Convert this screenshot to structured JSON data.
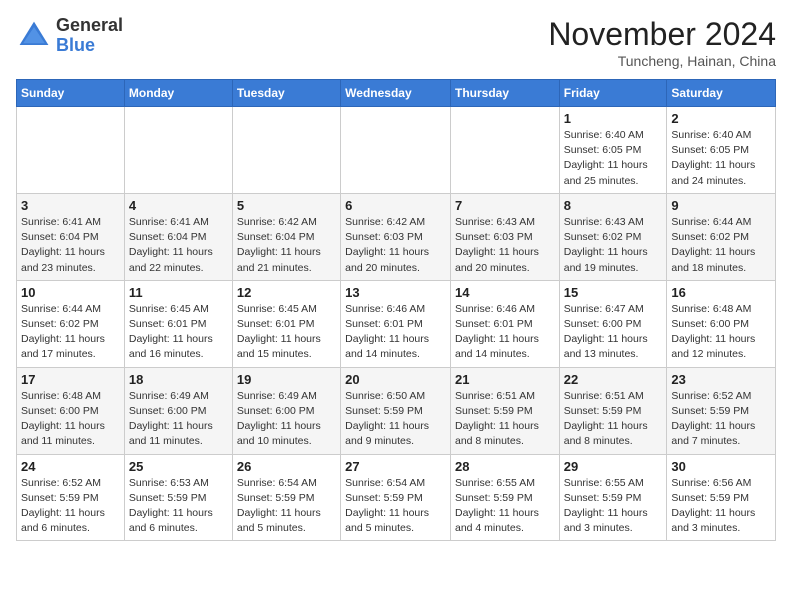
{
  "logo": {
    "general": "General",
    "blue": "Blue"
  },
  "header": {
    "month": "November 2024",
    "location": "Tuncheng, Hainan, China"
  },
  "weekdays": [
    "Sunday",
    "Monday",
    "Tuesday",
    "Wednesday",
    "Thursday",
    "Friday",
    "Saturday"
  ],
  "weeks": [
    [
      {
        "day": "",
        "info": ""
      },
      {
        "day": "",
        "info": ""
      },
      {
        "day": "",
        "info": ""
      },
      {
        "day": "",
        "info": ""
      },
      {
        "day": "",
        "info": ""
      },
      {
        "day": "1",
        "info": "Sunrise: 6:40 AM\nSunset: 6:05 PM\nDaylight: 11 hours and 25 minutes."
      },
      {
        "day": "2",
        "info": "Sunrise: 6:40 AM\nSunset: 6:05 PM\nDaylight: 11 hours and 24 minutes."
      }
    ],
    [
      {
        "day": "3",
        "info": "Sunrise: 6:41 AM\nSunset: 6:04 PM\nDaylight: 11 hours and 23 minutes."
      },
      {
        "day": "4",
        "info": "Sunrise: 6:41 AM\nSunset: 6:04 PM\nDaylight: 11 hours and 22 minutes."
      },
      {
        "day": "5",
        "info": "Sunrise: 6:42 AM\nSunset: 6:04 PM\nDaylight: 11 hours and 21 minutes."
      },
      {
        "day": "6",
        "info": "Sunrise: 6:42 AM\nSunset: 6:03 PM\nDaylight: 11 hours and 20 minutes."
      },
      {
        "day": "7",
        "info": "Sunrise: 6:43 AM\nSunset: 6:03 PM\nDaylight: 11 hours and 20 minutes."
      },
      {
        "day": "8",
        "info": "Sunrise: 6:43 AM\nSunset: 6:02 PM\nDaylight: 11 hours and 19 minutes."
      },
      {
        "day": "9",
        "info": "Sunrise: 6:44 AM\nSunset: 6:02 PM\nDaylight: 11 hours and 18 minutes."
      }
    ],
    [
      {
        "day": "10",
        "info": "Sunrise: 6:44 AM\nSunset: 6:02 PM\nDaylight: 11 hours and 17 minutes."
      },
      {
        "day": "11",
        "info": "Sunrise: 6:45 AM\nSunset: 6:01 PM\nDaylight: 11 hours and 16 minutes."
      },
      {
        "day": "12",
        "info": "Sunrise: 6:45 AM\nSunset: 6:01 PM\nDaylight: 11 hours and 15 minutes."
      },
      {
        "day": "13",
        "info": "Sunrise: 6:46 AM\nSunset: 6:01 PM\nDaylight: 11 hours and 14 minutes."
      },
      {
        "day": "14",
        "info": "Sunrise: 6:46 AM\nSunset: 6:01 PM\nDaylight: 11 hours and 14 minutes."
      },
      {
        "day": "15",
        "info": "Sunrise: 6:47 AM\nSunset: 6:00 PM\nDaylight: 11 hours and 13 minutes."
      },
      {
        "day": "16",
        "info": "Sunrise: 6:48 AM\nSunset: 6:00 PM\nDaylight: 11 hours and 12 minutes."
      }
    ],
    [
      {
        "day": "17",
        "info": "Sunrise: 6:48 AM\nSunset: 6:00 PM\nDaylight: 11 hours and 11 minutes."
      },
      {
        "day": "18",
        "info": "Sunrise: 6:49 AM\nSunset: 6:00 PM\nDaylight: 11 hours and 11 minutes."
      },
      {
        "day": "19",
        "info": "Sunrise: 6:49 AM\nSunset: 6:00 PM\nDaylight: 11 hours and 10 minutes."
      },
      {
        "day": "20",
        "info": "Sunrise: 6:50 AM\nSunset: 5:59 PM\nDaylight: 11 hours and 9 minutes."
      },
      {
        "day": "21",
        "info": "Sunrise: 6:51 AM\nSunset: 5:59 PM\nDaylight: 11 hours and 8 minutes."
      },
      {
        "day": "22",
        "info": "Sunrise: 6:51 AM\nSunset: 5:59 PM\nDaylight: 11 hours and 8 minutes."
      },
      {
        "day": "23",
        "info": "Sunrise: 6:52 AM\nSunset: 5:59 PM\nDaylight: 11 hours and 7 minutes."
      }
    ],
    [
      {
        "day": "24",
        "info": "Sunrise: 6:52 AM\nSunset: 5:59 PM\nDaylight: 11 hours and 6 minutes."
      },
      {
        "day": "25",
        "info": "Sunrise: 6:53 AM\nSunset: 5:59 PM\nDaylight: 11 hours and 6 minutes."
      },
      {
        "day": "26",
        "info": "Sunrise: 6:54 AM\nSunset: 5:59 PM\nDaylight: 11 hours and 5 minutes."
      },
      {
        "day": "27",
        "info": "Sunrise: 6:54 AM\nSunset: 5:59 PM\nDaylight: 11 hours and 5 minutes."
      },
      {
        "day": "28",
        "info": "Sunrise: 6:55 AM\nSunset: 5:59 PM\nDaylight: 11 hours and 4 minutes."
      },
      {
        "day": "29",
        "info": "Sunrise: 6:55 AM\nSunset: 5:59 PM\nDaylight: 11 hours and 3 minutes."
      },
      {
        "day": "30",
        "info": "Sunrise: 6:56 AM\nSunset: 5:59 PM\nDaylight: 11 hours and 3 minutes."
      }
    ]
  ]
}
